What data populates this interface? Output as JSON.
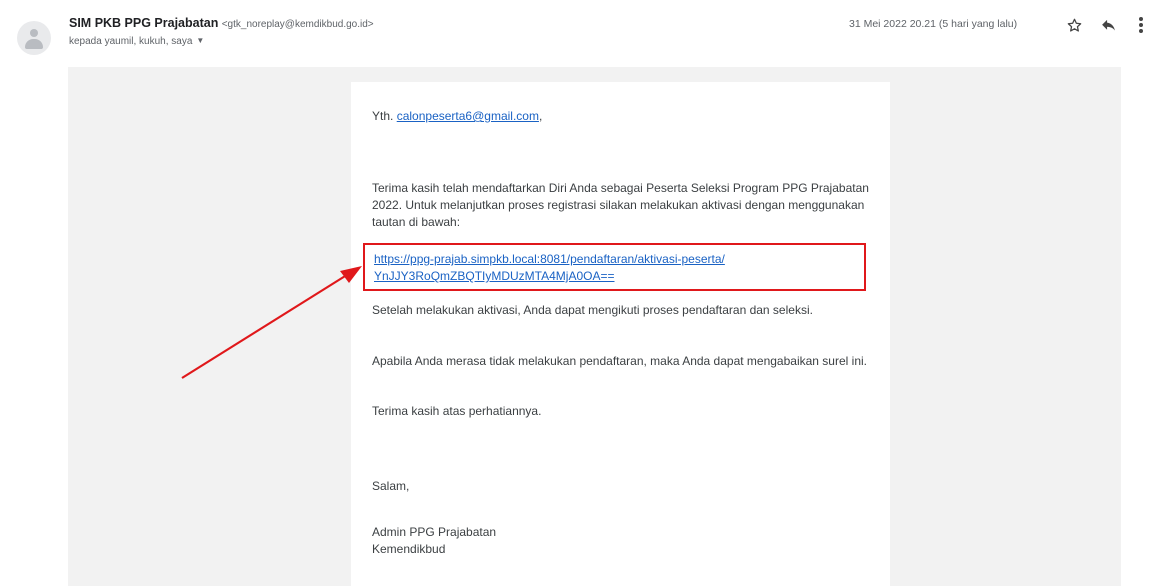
{
  "header": {
    "sender_name": "SIM PKB PPG Prajabatan",
    "sender_email": "<gtk_noreplay@kemdikbud.go.id>",
    "recipients": "kepada yaumil, kukuh, saya",
    "date": "31 Mei 2022 20.21 (5 hari yang lalu)",
    "icons": [
      "avatar",
      "star-icon",
      "reply-icon",
      "more-vert-icon"
    ]
  },
  "message": {
    "greeting_prefix": "Yth.",
    "greeting_email": "calonpeserta6@gmail.com",
    "greeting_suffix": ",",
    "para1": "Terima kasih telah mendaftarkan Diri Anda sebagai Peserta Seleksi Program PPG Prajabatan 2022. Untuk melanjutkan proses registrasi silakan melakukan aktivasi dengan menggunakan tautan di bawah:",
    "activation_link_line1": "https://ppg-prajab.simpkb.local:8081/pendaftaran/aktivasi-peserta/",
    "activation_link_line2": "YnJJY3RoQmZBQTIyMDUzMTA4MjA0OA==",
    "para2": "Setelah melakukan aktivasi, Anda dapat mengikuti proses pendaftaran dan seleksi.",
    "para3": "Apabila Anda merasa tidak melakukan pendaftaran, maka Anda dapat mengabaikan surel ini.",
    "para4": "Terima kasih atas perhatiannya.",
    "closing": "Salam,",
    "signature_line1": "Admin PPG Prajabatan",
    "signature_line2": "Kemendikbud"
  },
  "colors": {
    "highlight_box": "#e0181b",
    "link": "#1a62c4",
    "email_background": "#f2f2f2"
  }
}
